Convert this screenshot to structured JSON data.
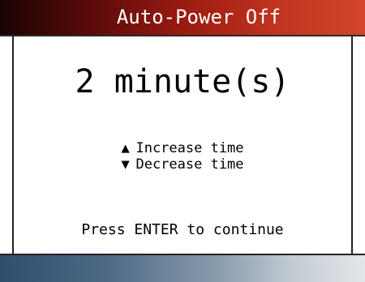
{
  "title": "Auto-Power Off",
  "value": "2 minute(s)",
  "options": [
    {
      "icon": "up-triangle-icon",
      "glyph": "▲",
      "label": "Increase time"
    },
    {
      "icon": "down-triangle-icon",
      "glyph": "▼",
      "label": "Decrease time"
    }
  ],
  "prompt": "Press ENTER to continue",
  "colors": {
    "title_bar_start": "#1a0303",
    "title_bar_end": "#d2452c",
    "footer_bar_start": "#2f4e6e",
    "footer_bar_end": "#e4e6e8",
    "background": "#ffffff",
    "text": "#000000"
  }
}
